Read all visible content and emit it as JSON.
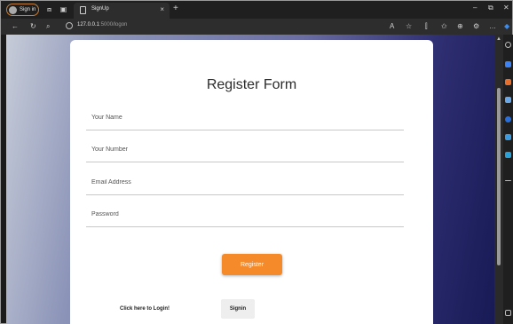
{
  "browser": {
    "profile_label": "Sign in",
    "tab_title": "SignUp",
    "tab_close": "×",
    "new_tab": "+",
    "url_host": "127.0.0.1",
    "url_path": ":5000/logon",
    "window_controls": {
      "minimize": "–",
      "restore": "⧉",
      "close": "✕"
    }
  },
  "page": {
    "heading": "Register Form",
    "fields": {
      "name_placeholder": "Your Name",
      "number_placeholder": "Your Number",
      "email_placeholder": "Email Address",
      "password_placeholder": "Password"
    },
    "register_label": "Register",
    "login_prompt": "Click here to Login!",
    "signin_label": "Signin"
  },
  "colors": {
    "accent": "#f58a2a",
    "card": "#ffffff",
    "gradient_start": "#c6ccd8",
    "gradient_end": "#171a55"
  }
}
